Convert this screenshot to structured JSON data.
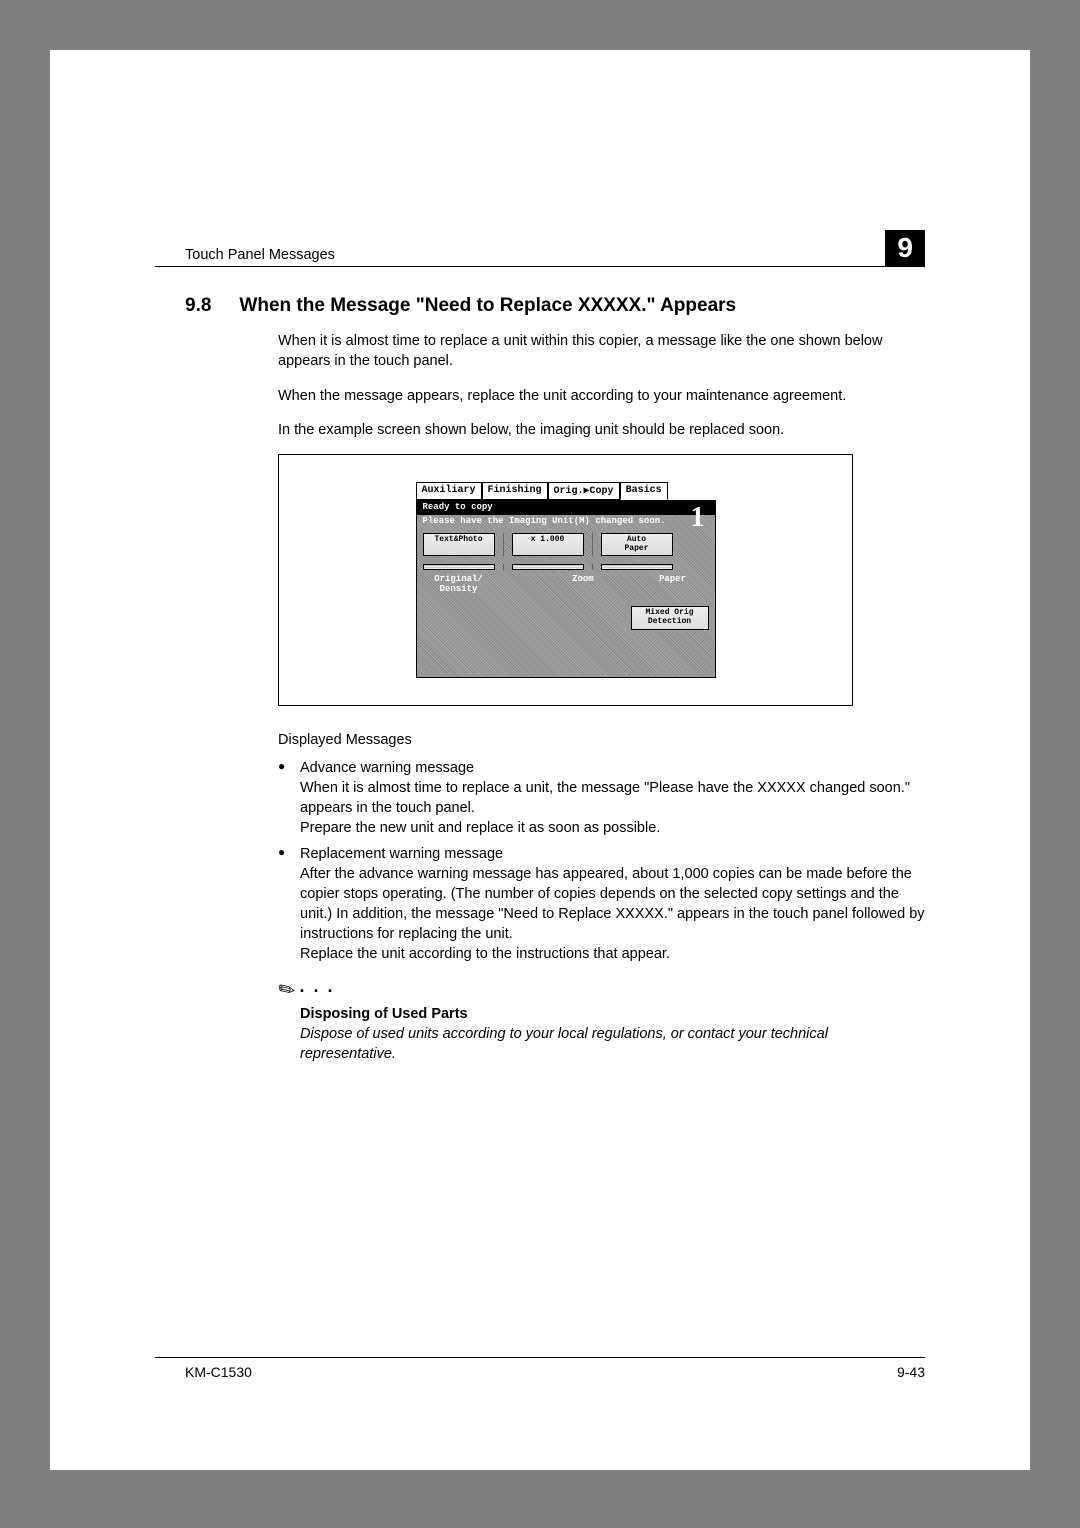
{
  "header": {
    "section_title": "Touch Panel Messages",
    "chapter_number": "9"
  },
  "section": {
    "number": "9.8",
    "title": "When the Message \"Need to Replace XXXXX.\" Appears"
  },
  "paragraphs": {
    "p1": "When it is almost time to replace a unit within this copier, a message like the one shown below appears in the touch panel.",
    "p2": "When the message appears, replace the unit according to your maintenance agreement.",
    "p3": "In the example screen shown below, the imaging unit should be replaced soon."
  },
  "panel": {
    "tabs": {
      "auxiliary": "Auxiliary",
      "finishing": "Finishing",
      "origcopy": "Orig.▶Copy",
      "basics": "Basics"
    },
    "status": "Ready to copy",
    "message": "Please have the Imaging Unit(M) changed soon.",
    "copy_count": "1",
    "buttons": {
      "textphoto": "Text&Photo",
      "zoom_val": "x 1.000",
      "autopaper": "Auto\nPaper",
      "mixed": "Mixed Orig\nDetection"
    },
    "labels": {
      "origdensity": "Original/\nDensity",
      "zoom": "Zoom",
      "paper": "Paper"
    }
  },
  "displayed_messages_heading": "Displayed Messages",
  "bullets": {
    "b1_title": "Advance warning message",
    "b1_body": "When it is almost time to replace a unit, the message \"Please have the XXXXX changed soon.\" appears in the touch panel.\nPrepare the new unit and replace it as soon as possible.",
    "b2_title": "Replacement warning message",
    "b2_body": "After the advance warning message has appeared, about 1,000 copies can be made before the copier stops operating. (The number of copies depends on the selected copy settings and the unit.) In addition, the message \"Need to Replace XXXXX.\" appears in the touch panel followed by instructions for replacing the unit.\nReplace the unit according to the instructions that appear."
  },
  "note": {
    "title": "Disposing of Used Parts",
    "body": "Dispose of used units according to your local regulations, or contact your technical representative."
  },
  "footer": {
    "model": "KM-C1530",
    "page": "9-43"
  }
}
